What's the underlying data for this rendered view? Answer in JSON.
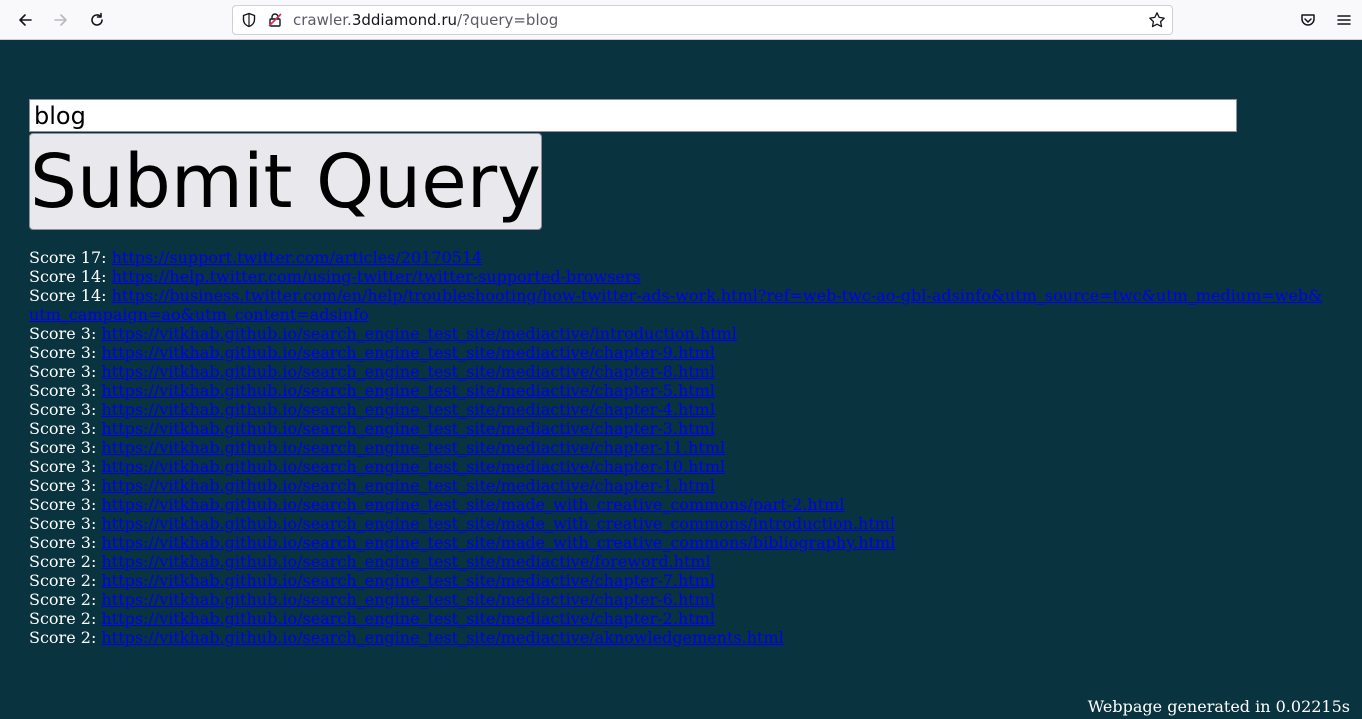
{
  "browser": {
    "url_prefix": "crawler.",
    "url_domain": "3ddiamond.ru",
    "url_suffix": "/?query=blog"
  },
  "search": {
    "value": "blog",
    "submit_label": "Submit Query"
  },
  "results": [
    {
      "score": "Score 17:",
      "url": "https://support.twitter.com/articles/20170514"
    },
    {
      "score": "Score 14:",
      "url": "https://help.twitter.com/using-twitter/twitter-supported-browsers"
    },
    {
      "score": "Score 14:",
      "url": "https://business.twitter.com/en/help/troubleshooting/how-twitter-ads-work.html?ref=web-twc-ao-gbl-adsinfo&utm_source=twc&utm_medium=web&utm_campaign=ao&utm_content=adsinfo"
    },
    {
      "score": "Score 3:",
      "url": "https://vitkhab.github.io/search_engine_test_site/mediactive/introduction.html"
    },
    {
      "score": "Score 3:",
      "url": "https://vitkhab.github.io/search_engine_test_site/mediactive/chapter-9.html"
    },
    {
      "score": "Score 3:",
      "url": "https://vitkhab.github.io/search_engine_test_site/mediactive/chapter-8.html"
    },
    {
      "score": "Score 3:",
      "url": "https://vitkhab.github.io/search_engine_test_site/mediactive/chapter-5.html"
    },
    {
      "score": "Score 3:",
      "url": "https://vitkhab.github.io/search_engine_test_site/mediactive/chapter-4.html"
    },
    {
      "score": "Score 3:",
      "url": "https://vitkhab.github.io/search_engine_test_site/mediactive/chapter-3.html"
    },
    {
      "score": "Score 3:",
      "url": "https://vitkhab.github.io/search_engine_test_site/mediactive/chapter-11.html"
    },
    {
      "score": "Score 3:",
      "url": "https://vitkhab.github.io/search_engine_test_site/mediactive/chapter-10.html"
    },
    {
      "score": "Score 3:",
      "url": "https://vitkhab.github.io/search_engine_test_site/mediactive/chapter-1.html"
    },
    {
      "score": "Score 3:",
      "url": "https://vitkhab.github.io/search_engine_test_site/made_with_creative_commons/part-2.html"
    },
    {
      "score": "Score 3:",
      "url": "https://vitkhab.github.io/search_engine_test_site/made_with_creative_commons/introduction.html"
    },
    {
      "score": "Score 3:",
      "url": "https://vitkhab.github.io/search_engine_test_site/made_with_creative_commons/bibliography.html"
    },
    {
      "score": "Score 2:",
      "url": "https://vitkhab.github.io/search_engine_test_site/mediactive/foreword.html"
    },
    {
      "score": "Score 2:",
      "url": "https://vitkhab.github.io/search_engine_test_site/mediactive/chapter-7.html"
    },
    {
      "score": "Score 2:",
      "url": "https://vitkhab.github.io/search_engine_test_site/mediactive/chapter-6.html"
    },
    {
      "score": "Score 2:",
      "url": "https://vitkhab.github.io/search_engine_test_site/mediactive/chapter-2.html"
    },
    {
      "score": "Score 2:",
      "url": "https://vitkhab.github.io/search_engine_test_site/mediactive/aknowledgements.html"
    }
  ],
  "footer": {
    "text": "Webpage generated in 0.02215s"
  }
}
